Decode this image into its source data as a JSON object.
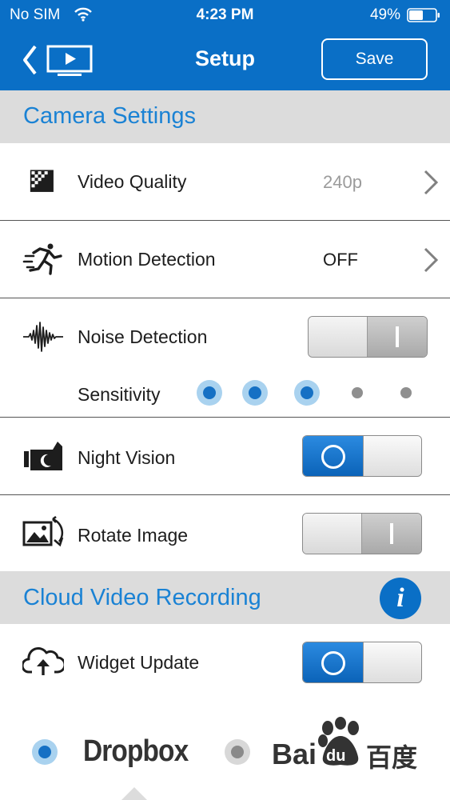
{
  "status_bar": {
    "carrier": "No SIM",
    "time": "4:23 PM",
    "battery": "49%"
  },
  "nav": {
    "title": "Setup",
    "save_label": "Save",
    "back_icon": "back-to-tv-icon"
  },
  "camera_settings": {
    "header": "Camera Settings",
    "video_quality": {
      "label": "Video Quality",
      "value": "240p"
    },
    "motion_detection": {
      "label": "Motion Detection",
      "value": "OFF"
    },
    "noise_detection": {
      "label": "Noise Detection",
      "enabled": false
    },
    "sensitivity": {
      "label": "Sensitivity",
      "level": 3,
      "max": 5
    },
    "night_vision": {
      "label": "Night Vision",
      "enabled": true
    },
    "rotate_image": {
      "label": "Rotate Image",
      "enabled": false
    }
  },
  "cloud_video_recording": {
    "header": "Cloud Video Recording",
    "info_label": "i",
    "widget_update": {
      "label": "Widget Update",
      "enabled": true
    },
    "providers": [
      {
        "name": "Dropbox",
        "selected": true
      },
      {
        "name": "Bai",
        "suffix": "du",
        "cn": "百度",
        "selected": false
      }
    ]
  },
  "colors": {
    "accent": "#0a6fc6",
    "section_header_bg": "#dcdcdc",
    "section_header_text": "#1a82d4"
  }
}
